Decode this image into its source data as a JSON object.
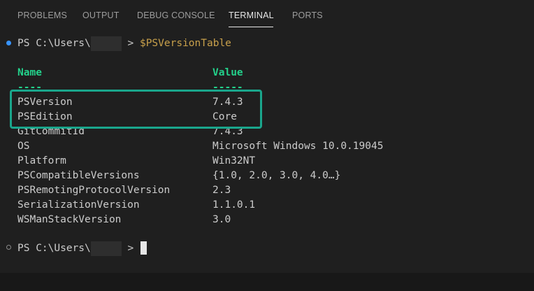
{
  "tabs": [
    {
      "label": "PROBLEMS"
    },
    {
      "label": "OUTPUT"
    },
    {
      "label": "DEBUG CONSOLE"
    },
    {
      "label": "TERMINAL"
    },
    {
      "label": "PORTS"
    }
  ],
  "active_tab": "TERMINAL",
  "terminal": {
    "prompt_prefix": "PS C:\\Users\\",
    "prompt_suffix": " > ",
    "command": "$PSVersionTable",
    "header": {
      "name": "Name",
      "value": "Value"
    },
    "separator": {
      "name": "----",
      "value": "-----"
    },
    "rows": [
      {
        "name": "PSVersion",
        "value": "7.4.3"
      },
      {
        "name": "PSEdition",
        "value": "Core"
      },
      {
        "name": "GitCommitId",
        "value": "7.4.3"
      },
      {
        "name": "OS",
        "value": "Microsoft Windows 10.0.19045"
      },
      {
        "name": "Platform",
        "value": "Win32NT"
      },
      {
        "name": "PSCompatibleVersions",
        "value": "{1.0, 2.0, 3.0, 4.0…}"
      },
      {
        "name": "PSRemotingProtocolVersion",
        "value": "2.3"
      },
      {
        "name": "SerializationVersion",
        "value": "1.1.0.1"
      },
      {
        "name": "WSManStackVersion",
        "value": "3.0"
      }
    ]
  },
  "colors": {
    "accent_highlight": "#1aa68c",
    "command": "#c8a04b",
    "header": "#23d18b"
  }
}
